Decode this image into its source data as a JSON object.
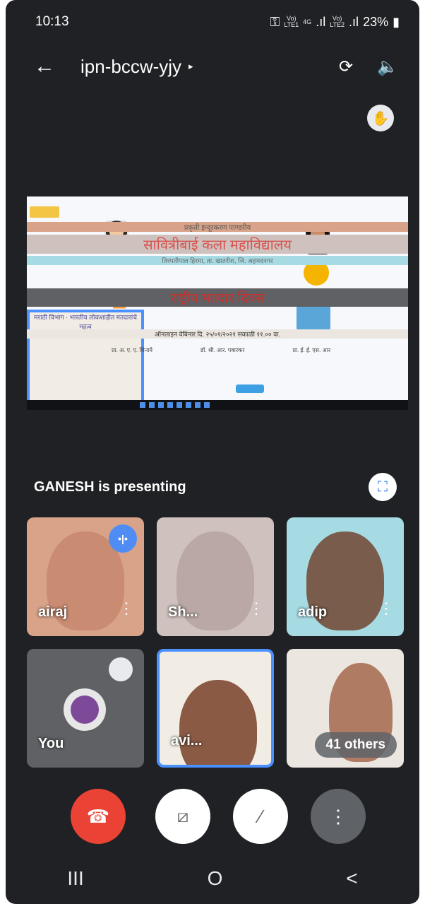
{
  "status": {
    "time": "10:13",
    "key_icon": "key-icon",
    "sim1_top": "Vo)",
    "sim1_bottom": "LTE1",
    "net": "4G",
    "sim2_top": "Vo)",
    "sim2_bottom": "LTE2",
    "battery": "23%"
  },
  "topbar": {
    "back_icon": "←",
    "meeting_code": "ipn-bccw-yjy",
    "chevron": "▸",
    "switch_camera_icon": "⟳",
    "speaker_icon": "🔈"
  },
  "raise_hand_icon": "✋",
  "shared_screen": {
    "header": "प्रकृती इन्दूरकरण पाण्डरीय",
    "college": "सावित्रीबाई कला महाविद्यालय",
    "sub": "तिरपतीपाल हिरमा, ता. खातरीश, जि. अहमदनगर",
    "event": "राष्ट्रीय मतदार दिवस",
    "organizer": "मराठी विभाग · भारतीय लोकशाहीत मतदारांचे महत्व",
    "date_line": "ऑनलाइन वेबिनार दि. २५/०१/२०२१ सकाळी ११.०० वा.",
    "col1": "प्रा. अ. ए. ए. शिनाये",
    "col2": "डॉ. श्री. आर. पवारकर",
    "col3": "प्रा. ई. ई. एस. आर"
  },
  "presenting": {
    "text": "GANESH is presenting",
    "fullscreen_icon": "⛶"
  },
  "participants": [
    {
      "name": "airaj",
      "speaking": true
    },
    {
      "name": "Sh..."
    },
    {
      "name": "adip"
    },
    {
      "name": "You"
    },
    {
      "name": "avi..."
    },
    {
      "name": "41 others"
    }
  ],
  "controls": {
    "end_icon": "☎",
    "camera_icon": "⧄",
    "mic_icon": "⁄",
    "more_icon": "⋮"
  },
  "nav": {
    "recents": "III",
    "home": "O",
    "back": "<"
  },
  "colors": {
    "background": "#202124",
    "end_call": "#ea4335",
    "accent": "#4a90ff"
  }
}
